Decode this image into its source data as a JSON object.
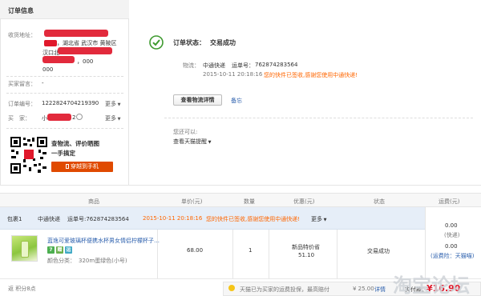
{
  "order_info": {
    "title": "订单信息",
    "address_label": "收货地址：",
    "address_part1": "，湖北省 武汉市 黄陂区",
    "address_part2": "汉口北",
    "address_part3": "，000",
    "address_part4": "000",
    "message_label": "买家留言：",
    "message_value": "-",
    "order_no_label": "订单编号：",
    "order_no_value": "1222824704219390",
    "more_label": "更多",
    "buyer_label": "买　家：",
    "buyer_value_prefix": "小",
    "buyer_value_suffix": "2",
    "qr_text_line1": "查物流、评价晒图",
    "qr_text_line2": "一手搞定",
    "qr_button": "穿越到手机"
  },
  "status": {
    "label": "订单状态：",
    "value": "交易成功",
    "logistics_label": "物流：",
    "carrier": "中通快递",
    "tracking_label": "运单号：",
    "tracking_no": "762874283564",
    "datetime": "2015-10-11 20:18:16",
    "message": "您的快件已签收,感谢您使用中通快递!",
    "detail_button": "查看物流详情",
    "memo_link": "备忘",
    "can_also": "您还可以:",
    "reminder": "查看天猫提醒"
  },
  "table": {
    "headers": [
      "商品",
      "单价(元)",
      "数量",
      "优惠(元)",
      "状态",
      "运费(元)"
    ],
    "package": {
      "label": "包裹1",
      "carrier": "中通快递",
      "tracking": "运单号:762874283564",
      "datetime": "2015-10-11 20:18:16",
      "message": "您的快件已签收,感谢您使用中通快递!",
      "more": "更多"
    },
    "item": {
      "name": "蓝逸可爱玻璃杯便携水杯男女情侣柠檬杯子…",
      "badges": [
        "7",
        "赠",
        "运"
      ],
      "spec_label": "颜色分类：",
      "spec_value": "320m蛋绿色(小号)",
      "price": "68.00",
      "quantity": "1",
      "discount_label": "新品特价省",
      "discount_value": "51.10",
      "status": "交易成功"
    },
    "fee": {
      "value1": "0.00",
      "method": "(快递)",
      "value2": "0.00",
      "insurance": "(运费险：天猫喵)"
    }
  },
  "footer": {
    "points": "返 积分8点",
    "notice": "天猫已为买家的运费投保，最高赔付",
    "amount": "¥ 25.00",
    "details": "详情",
    "total_label": "实付款：",
    "total": "¥16.90",
    "watermark": "淘宝论坛"
  },
  "colors": {
    "accent_red": "#e0182b",
    "accent_orange": "#ff6600",
    "success_green": "#3e9a2f",
    "link_blue": "#2b5fad",
    "package_row_bg": "#e6eef8"
  }
}
